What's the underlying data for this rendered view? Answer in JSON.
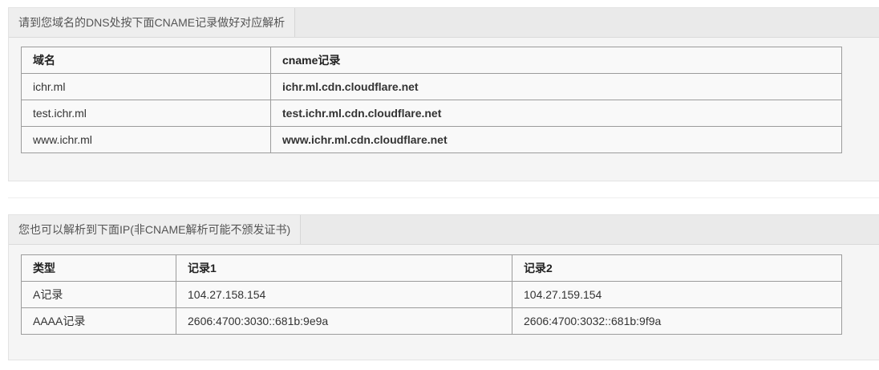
{
  "cname_section": {
    "header": "请到您域名的DNS处按下面CNAME记录做好对应解析",
    "columns": [
      "域名",
      "cname记录"
    ],
    "rows": [
      {
        "domain": "ichr.ml",
        "cname": "ichr.ml.cdn.cloudflare.net"
      },
      {
        "domain": "test.ichr.ml",
        "cname": "test.ichr.ml.cdn.cloudflare.net"
      },
      {
        "domain": "www.ichr.ml",
        "cname": "www.ichr.ml.cdn.cloudflare.net"
      }
    ]
  },
  "ip_section": {
    "header": "您也可以解析到下面IP(非CNAME解析可能不颁发证书)",
    "columns": [
      "类型",
      "记录1",
      "记录2"
    ],
    "rows": [
      {
        "type": "A记录",
        "record1": "104.27.158.154",
        "record2": "104.27.159.154"
      },
      {
        "type": "AAAA记录",
        "record1": "2606:4700:3030::681b:9e9a",
        "record2": "2606:4700:3032::681b:9f9a"
      }
    ]
  }
}
